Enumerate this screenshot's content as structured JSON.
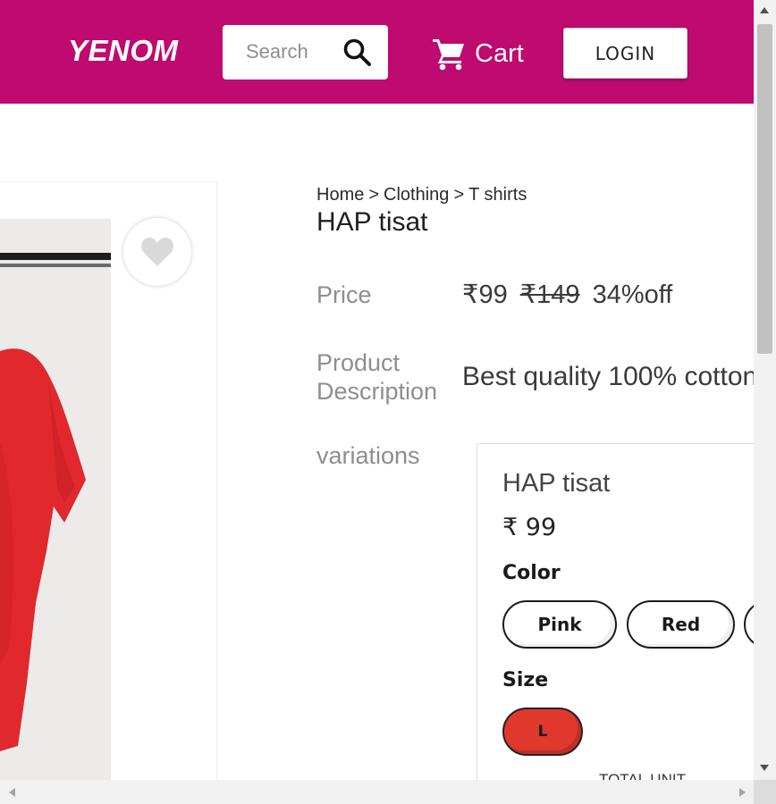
{
  "header": {
    "logo": "YENOM",
    "search_placeholder": "Search",
    "cart_label": "Cart",
    "login_label": "LOGIN",
    "brand_color": "#bf0a6f"
  },
  "breadcrumb": {
    "items": [
      "Home",
      "Clothing",
      "T shirts"
    ],
    "separator": ">"
  },
  "product": {
    "title": "HAP tisat",
    "price_label": "Price",
    "price": "₹99",
    "mrp": "₹149",
    "discount": "34%off",
    "description_label_line1": "Product",
    "description_label_line2": "Description",
    "description": "Best quality 100% cotton",
    "variations_label": "variations"
  },
  "variation": {
    "name": "HAP tisat",
    "price": "₹ 99",
    "color_heading": "Color",
    "colors": [
      "Pink",
      "Red"
    ],
    "size_heading": "Size",
    "sizes": [
      "L"
    ],
    "selected_size": "L",
    "total_unit_label": "TOTAL UNIT"
  },
  "icons": {
    "search": "search-icon",
    "cart": "cart-icon",
    "wishlist": "heart-icon"
  },
  "colors": {
    "product_red": "#e0382d",
    "heart_grey": "#d9d9d9"
  }
}
